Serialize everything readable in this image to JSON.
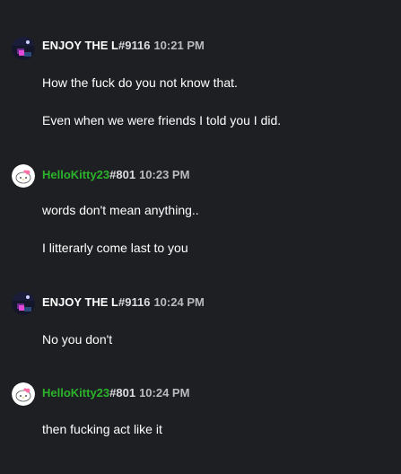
{
  "messages": [
    {
      "author": "ENJOY THE L",
      "tag": "#9116",
      "time": "10:21 PM",
      "lines": [
        "How the fuck do you not know that.",
        "Even when we were friends I told you I did."
      ]
    },
    {
      "author": "HelloKitty23",
      "tag": "#801",
      "time": "10:23 PM",
      "lines": [
        "words don't mean anything..",
        "I litterarly come last to you"
      ]
    },
    {
      "author": "ENJOY THE L",
      "tag": "#9116",
      "time": "10:24 PM",
      "lines": [
        "No you don't"
      ]
    },
    {
      "author": "HelloKitty23",
      "tag": "#801",
      "time": "10:24 PM",
      "lines": [
        "then fucking act like it"
      ]
    }
  ],
  "colors": {
    "background": "#1e1f22",
    "name_default": "#ffffff",
    "name_hellokitty": "#2bb32b",
    "timestamp": "#b9bbbe",
    "message_text": "#ffffff"
  },
  "icons": {
    "enjoy_avatar": "dark-night-sky-avatar-icon",
    "hellokitty_avatar": "hello-kitty-avatar-icon"
  }
}
